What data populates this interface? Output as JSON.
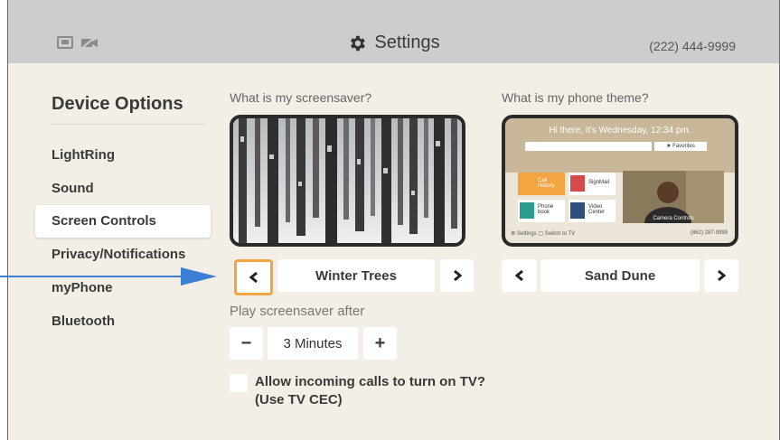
{
  "header": {
    "title": "Settings",
    "phone_number": "(222) 444-9999"
  },
  "sidebar": {
    "title": "Device Options",
    "selected_index": 2,
    "items": [
      {
        "label": "LightRing"
      },
      {
        "label": "Sound"
      },
      {
        "label": "Screen Controls"
      },
      {
        "label": "Privacy/Notifications"
      },
      {
        "label": "myPhone"
      },
      {
        "label": "Bluetooth"
      }
    ]
  },
  "screensaver": {
    "question": "What is my screensaver?",
    "value": "Winter Trees"
  },
  "phone_theme": {
    "question": "What is my phone theme?",
    "value": "Sand Dune",
    "preview": {
      "greeting": "Hi there, it's Wednesday, 12:34 pm.",
      "favorites": "★ Favorites",
      "tiles": [
        "Call History",
        "SignMail",
        "Phone book",
        "Video Center"
      ],
      "camera_controls": "Camera Controls",
      "footer_left": "⚙ Settings  ▢ Switch to TV",
      "footer_right": "(862) 287-9999"
    }
  },
  "screensaver_delay": {
    "label": "Play screensaver after",
    "value": "3 Minutes",
    "minus": "−",
    "plus": "+"
  },
  "tv_cec": {
    "label_line1": "Allow incoming calls to turn on TV?",
    "label_line2": "(Use TV CEC)",
    "checked": false
  },
  "colors": {
    "focus": "#f2a541",
    "annotation_arrow": "#3b7fd4",
    "background": "#f3efe7",
    "topbar": "#cdcdcd"
  }
}
